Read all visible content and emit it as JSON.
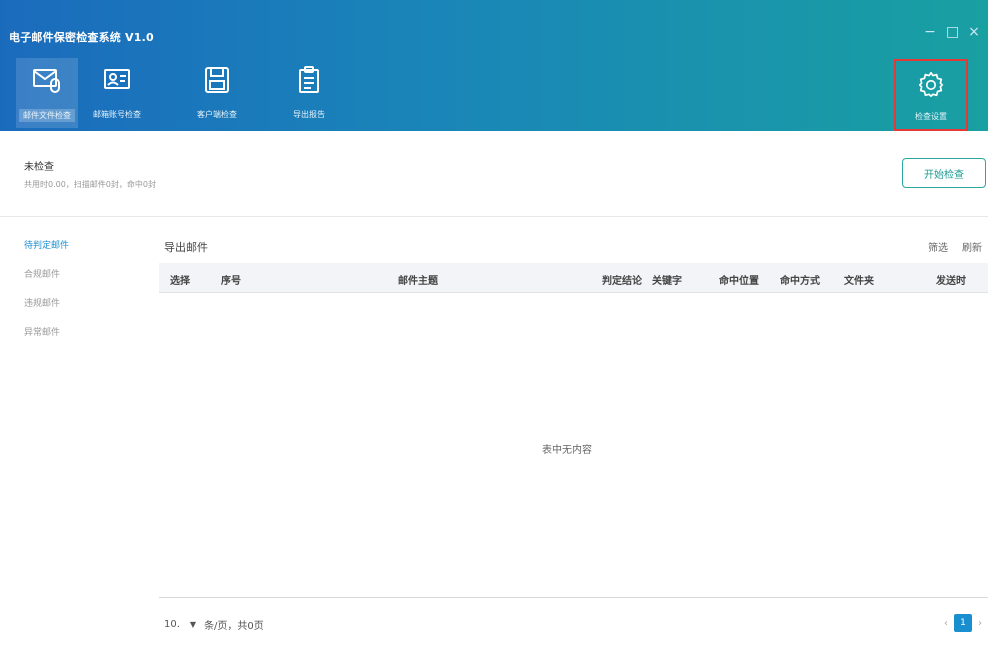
{
  "app": {
    "title": "电子邮件保密检查系统 V1.0"
  },
  "window": {
    "minimize": "−",
    "maximize": "□",
    "close": "×"
  },
  "toolbar": {
    "items": [
      {
        "label": "邮件文件检查",
        "icon": "mail-attachment-icon",
        "active": true
      },
      {
        "label": "邮箱账号检查",
        "icon": "account-card-icon",
        "active": false
      },
      {
        "label": "客户端检查",
        "icon": "client-save-icon",
        "active": false
      },
      {
        "label": "导出报告",
        "icon": "clipboard-report-icon",
        "active": false
      }
    ],
    "settings": {
      "label": "检查设置",
      "icon": "gear-icon",
      "highlight_color": "#e53935"
    }
  },
  "status": {
    "title": "未检查",
    "subtitle": "共用时0.00，扫描邮件0封，命中0封",
    "start_button": "开始检查"
  },
  "sidebar": {
    "items": [
      {
        "label": "待判定邮件",
        "active": true
      },
      {
        "label": "合规邮件",
        "active": false
      },
      {
        "label": "违规邮件",
        "active": false
      },
      {
        "label": "异常邮件",
        "active": false
      }
    ]
  },
  "main": {
    "export_label": "导出邮件",
    "filter_label": "筛选",
    "refresh_label": "刷新",
    "table": {
      "columns": [
        "选择",
        "序号",
        "邮件主题",
        "判定结论",
        "关键字",
        "命中位置",
        "命中方式",
        "文件夹",
        "发送时"
      ],
      "empty_text": "表中无内容"
    },
    "pagination": {
      "page_size": "10.",
      "per_page_text": "条/页，共0页",
      "current_page": "1",
      "prev": "‹",
      "next": "›"
    }
  },
  "colors": {
    "header_start": "#1b6bbd",
    "header_end": "#19a0a2",
    "accent": "#1a8fd0",
    "start_button": "#2aa8a0"
  }
}
